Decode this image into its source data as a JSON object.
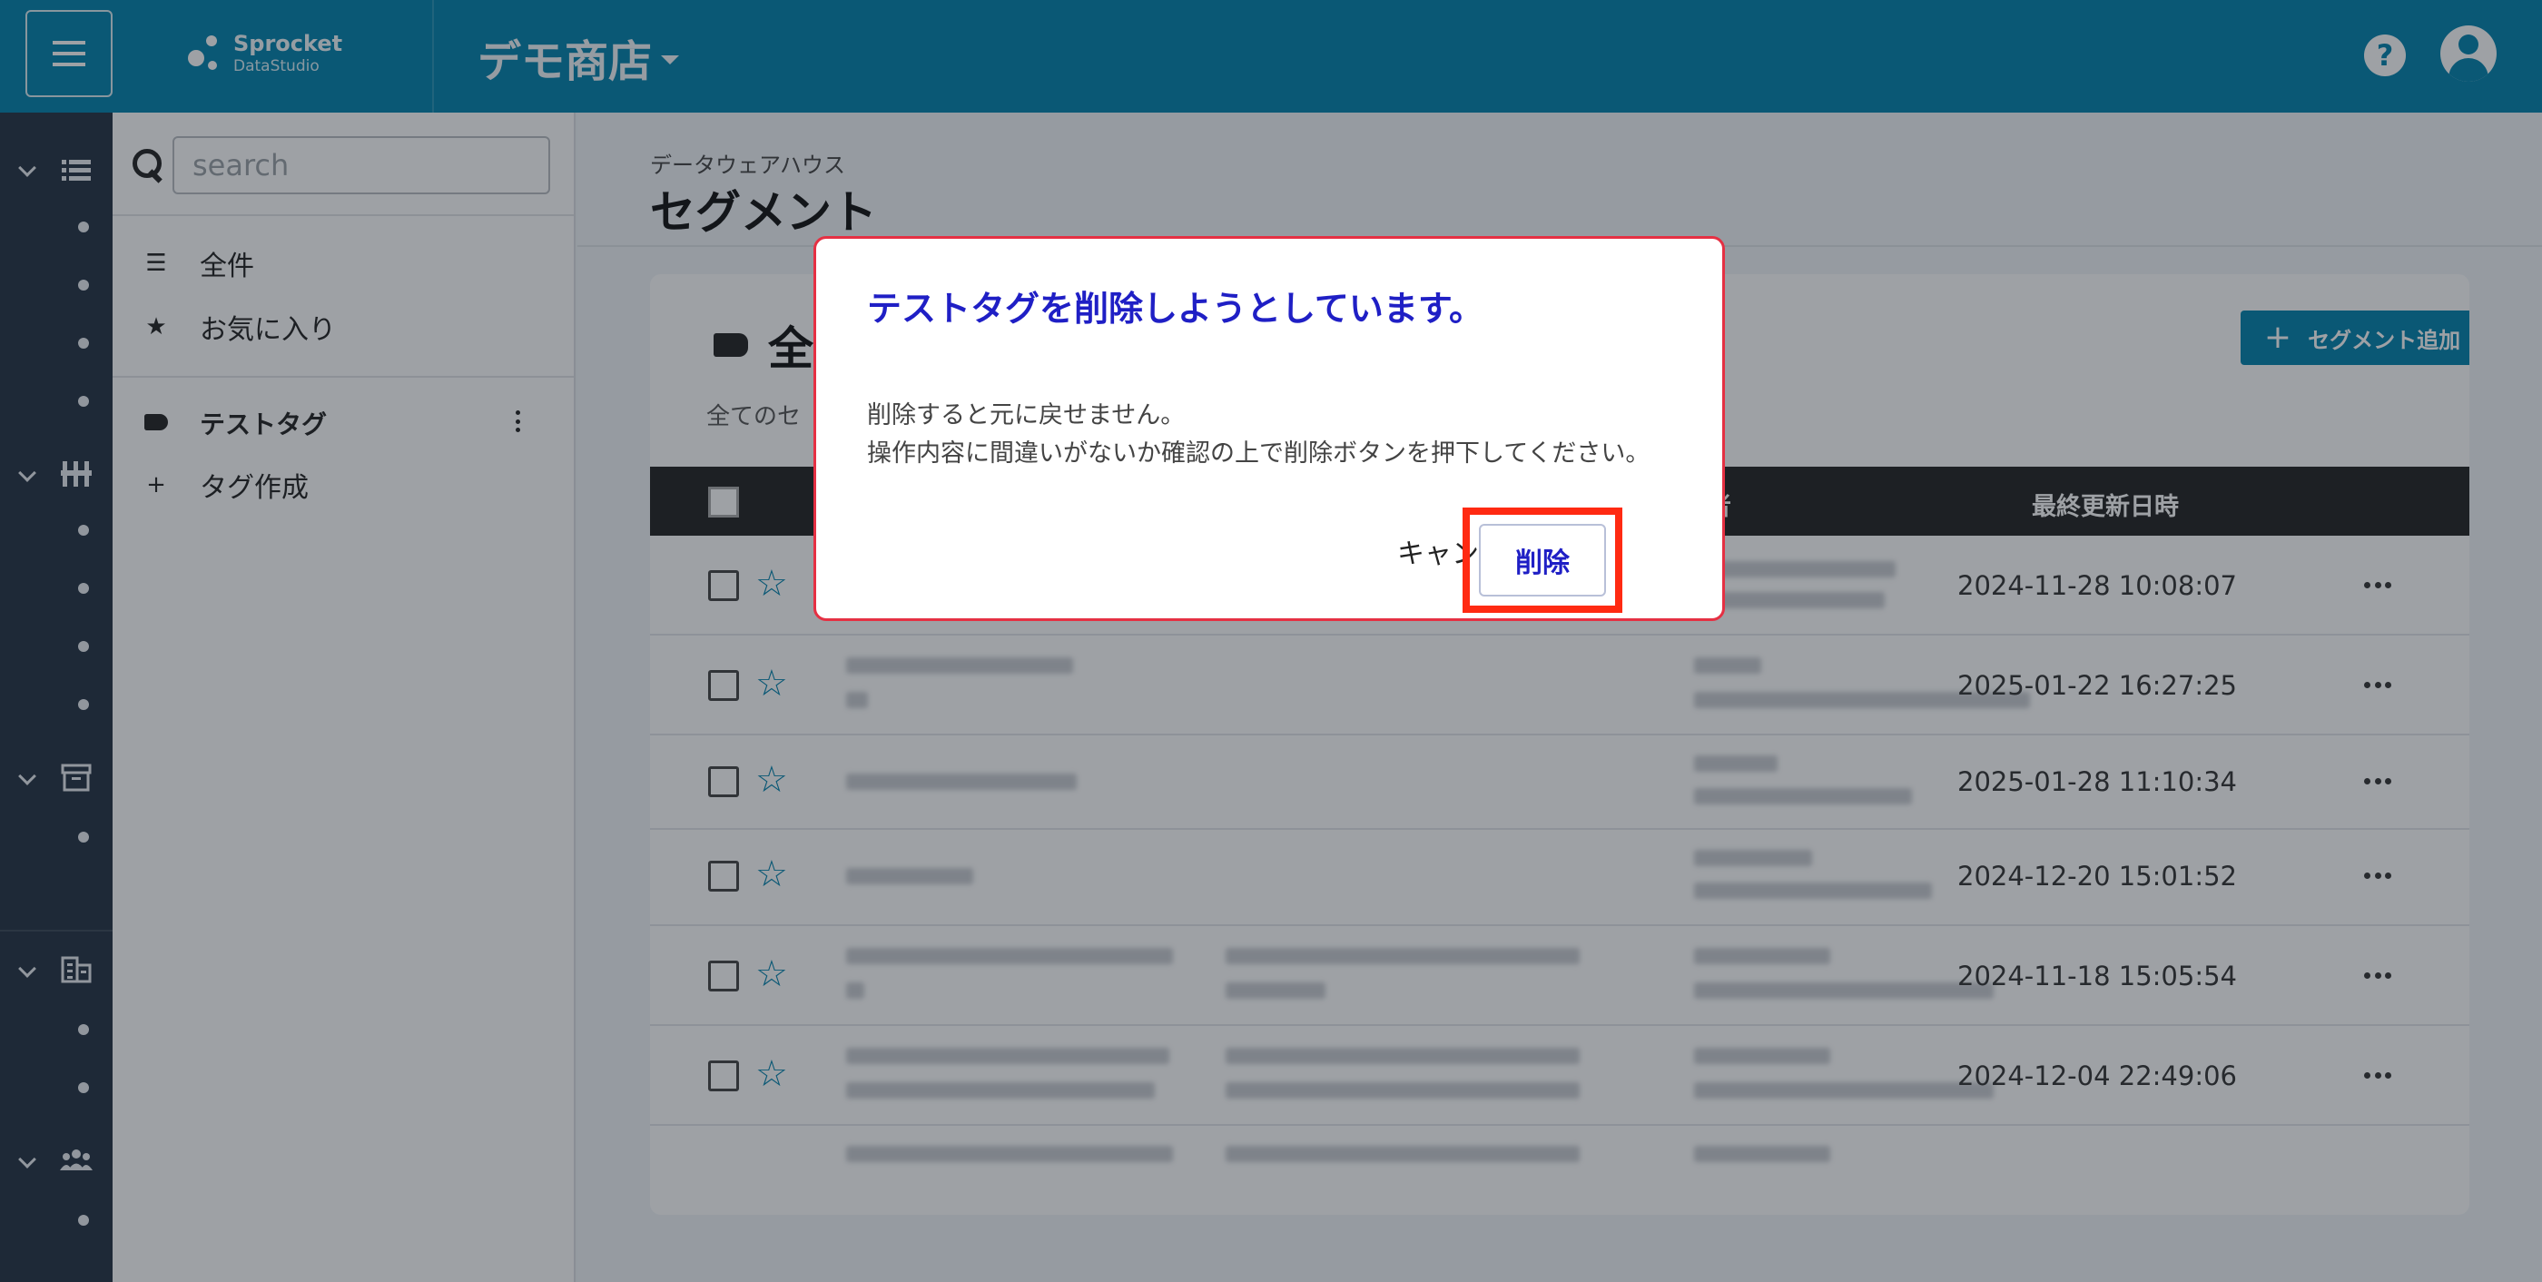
{
  "header": {
    "logo_title": "Sprocket",
    "logo_subtitle": "DataStudio",
    "shop_name": "デモ商店"
  },
  "sidebar": {
    "search_placeholder": "search",
    "items": [
      {
        "label": "全件",
        "icon": "list-icon"
      },
      {
        "label": "お気に入り",
        "icon": "star-icon"
      }
    ],
    "tag": {
      "label": "テストタグ",
      "icon": "tag-icon"
    },
    "create_tag": "タグ作成"
  },
  "main": {
    "breadcrumb": "データウェアハウス",
    "title": "セグメント",
    "card_title": "全件",
    "card_subtitle": "全てのセ",
    "add_button": "セグメント追加",
    "columns": [
      "者",
      "最終更新日時"
    ],
    "rows": [
      {
        "updated": "2024-11-28 10:08:07"
      },
      {
        "updated": "2025-01-22 16:27:25"
      },
      {
        "updated": "2025-01-28 11:10:34"
      },
      {
        "updated": "2024-12-20 15:01:52"
      },
      {
        "updated": "2024-11-18 15:05:54"
      },
      {
        "updated": "2024-12-04 22:49:06"
      }
    ]
  },
  "modal": {
    "title": "テストタグを削除しようとしています。",
    "body_line1": "削除すると元に戻せません。",
    "body_line2": "操作内容に間違いがないか確認の上で削除ボタンを押下してください。",
    "cancel": "キャンセル",
    "delete": "削除"
  },
  "colors": {
    "header": "#0082ad",
    "rail": "#243142",
    "modal_title": "#1f1fc5",
    "modal_border": "#e53043",
    "highlight": "#ff2a12"
  }
}
